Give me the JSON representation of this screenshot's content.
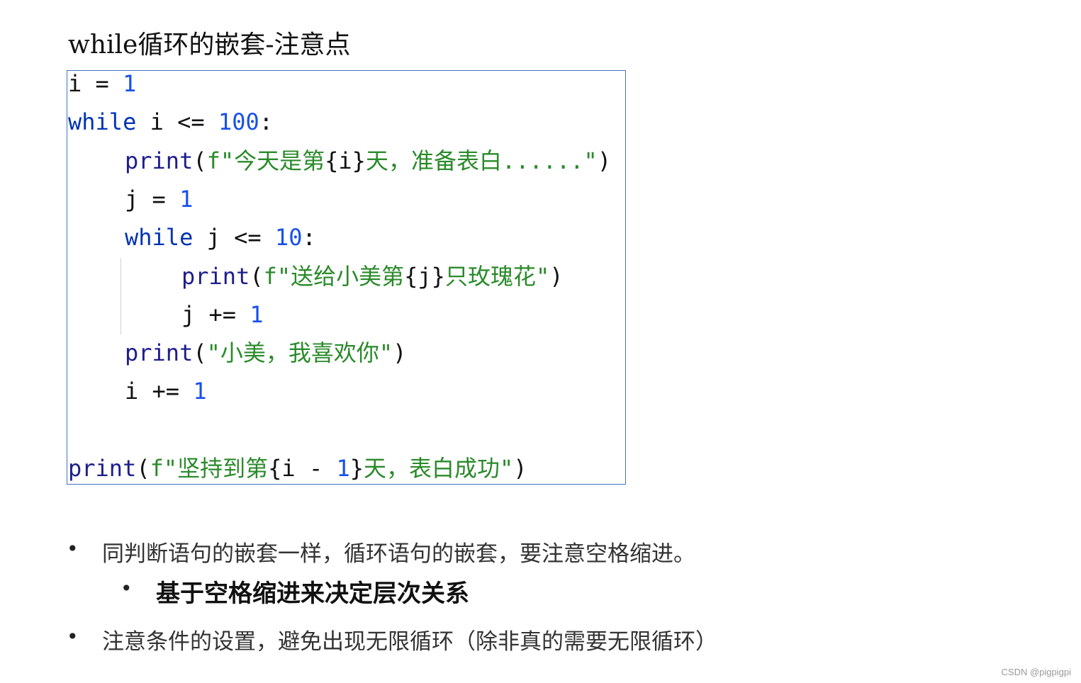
{
  "title": "while循环的嵌套-注意点",
  "code": {
    "lines": [
      {
        "indent": 0,
        "tokens": [
          [
            "i = ",
            "pl"
          ],
          [
            "1",
            "num"
          ]
        ]
      },
      {
        "indent": 0,
        "tokens": [
          [
            "while",
            "kw"
          ],
          [
            " i <= ",
            "pl"
          ],
          [
            "100",
            "num"
          ],
          [
            ":",
            "pl"
          ]
        ]
      },
      {
        "indent": 4,
        "tokens": [
          [
            "print",
            "fn"
          ],
          [
            "(",
            "pl"
          ],
          [
            "f\"今天是第",
            "str"
          ],
          [
            "{i}",
            "pl"
          ],
          [
            "天，准备表白......\"",
            "str"
          ],
          [
            ")",
            "pl"
          ]
        ]
      },
      {
        "indent": 4,
        "tokens": [
          [
            "j = ",
            "pl"
          ],
          [
            "1",
            "num"
          ]
        ]
      },
      {
        "indent": 4,
        "tokens": [
          [
            "while",
            "kw"
          ],
          [
            " j <= ",
            "pl"
          ],
          [
            "10",
            "num"
          ],
          [
            ":",
            "pl"
          ]
        ]
      },
      {
        "indent": 8,
        "tokens": [
          [
            "print",
            "fn"
          ],
          [
            "(",
            "pl"
          ],
          [
            "f\"送给小美第",
            "str"
          ],
          [
            "{j}",
            "pl"
          ],
          [
            "只玫瑰花\"",
            "str"
          ],
          [
            ")",
            "pl"
          ]
        ]
      },
      {
        "indent": 8,
        "tokens": [
          [
            "j += ",
            "pl"
          ],
          [
            "1",
            "num"
          ]
        ]
      },
      {
        "indent": 4,
        "tokens": [
          [
            "print",
            "fn"
          ],
          [
            "(",
            "pl"
          ],
          [
            "\"小美，我喜欢你\"",
            "str"
          ],
          [
            ")",
            "pl"
          ]
        ]
      },
      {
        "indent": 4,
        "tokens": [
          [
            "i += ",
            "pl"
          ],
          [
            "1",
            "num"
          ]
        ]
      },
      {
        "indent": 0,
        "tokens": []
      },
      {
        "indent": 0,
        "tokens": [
          [
            "print",
            "fn"
          ],
          [
            "(",
            "pl"
          ],
          [
            "f\"坚持到第",
            "str"
          ],
          [
            "{i - ",
            "pl"
          ],
          [
            "1",
            "num"
          ],
          [
            "}",
            "pl"
          ],
          [
            "天，表白成功\"",
            "str"
          ],
          [
            ")",
            "pl"
          ]
        ]
      }
    ]
  },
  "bullets": [
    {
      "text": "同判断语句的嵌套一样，循环语句的嵌套，要注意空格缩进。",
      "level": 1
    },
    {
      "text": "基于空格缩进来决定层次关系",
      "level": 2
    },
    {
      "text": "注意条件的设置，避免出现无限循环（除非真的需要无限循环）",
      "level": 1
    }
  ],
  "bullet_symbol": "•",
  "watermark": "CSDN @pigpigpi",
  "colors": {
    "keyword": "#0033b3",
    "function": "#1e1e8c",
    "number": "#1750eb",
    "string": "#2a8a2a",
    "border": "#4472c4"
  }
}
